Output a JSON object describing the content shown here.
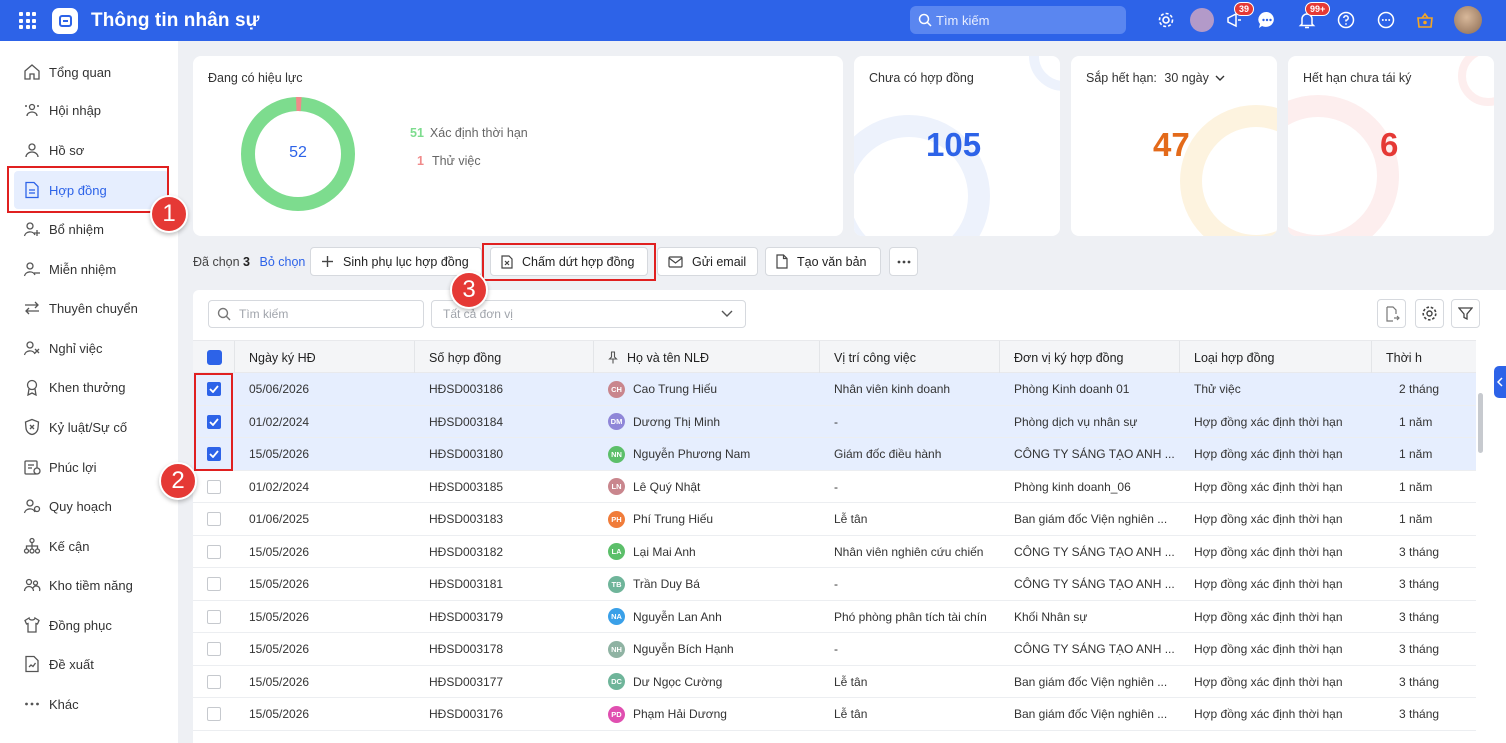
{
  "header": {
    "title": "Thông tin nhân sự",
    "search_placeholder": "Tìm kiếm",
    "announce_badge": "39",
    "notify_badge": "99+"
  },
  "sidebar": {
    "items": [
      {
        "label": "Tổng quan",
        "icon": "home-icon"
      },
      {
        "label": "Hội nhập",
        "icon": "onboarding-icon"
      },
      {
        "label": "Hồ sơ",
        "icon": "user-icon"
      },
      {
        "label": "Hợp đồng",
        "icon": "contract-icon",
        "active": true
      },
      {
        "label": "Bổ nhiệm",
        "icon": "user-plus-icon"
      },
      {
        "label": "Miễn nhiệm",
        "icon": "user-minus-icon"
      },
      {
        "label": "Thuyên chuyển",
        "icon": "transfer-icon"
      },
      {
        "label": "Nghỉ việc",
        "icon": "user-x-icon"
      },
      {
        "label": "Khen thưởng",
        "icon": "reward-icon"
      },
      {
        "label": "Kỷ luật/Sự cố",
        "icon": "shield-icon"
      },
      {
        "label": "Phúc lợi",
        "icon": "benefit-icon"
      },
      {
        "label": "Quy hoạch",
        "icon": "planning-icon"
      },
      {
        "label": "Kế cận",
        "icon": "hierarchy-icon"
      },
      {
        "label": "Kho tiềm năng",
        "icon": "talent-pool-icon"
      },
      {
        "label": "Đồng phục",
        "icon": "shirt-icon"
      },
      {
        "label": "Đề xuất",
        "icon": "proposal-icon"
      },
      {
        "label": "Khác",
        "icon": "more-icon"
      }
    ]
  },
  "cards": {
    "effective": {
      "title": "Đang có hiệu lực",
      "total": "52",
      "legend": [
        {
          "count": "51",
          "label": "Xác định thời hạn",
          "color": "#7ddc8e"
        },
        {
          "count": "1",
          "label": "Thử việc",
          "color": "#f08a8a"
        }
      ]
    },
    "no_contract": {
      "title": "Chưa có hợp đồng",
      "value": "105",
      "color": "#2d63e8"
    },
    "expiring": {
      "title": "Sắp hết hạn:",
      "period": "30 ngày",
      "value": "47",
      "color": "#e36a1a"
    },
    "expired": {
      "title": "Hết hạn chưa tái ký",
      "value": "6",
      "color": "#e53935"
    }
  },
  "actions": {
    "selected_prefix": "Đã chọn",
    "selected_count": "3",
    "deselect": "Bỏ chọn",
    "buttons": [
      "Sinh phụ lục hợp đồng",
      "Chấm dứt hợp đồng",
      "Gửi email",
      "Tạo văn bản"
    ]
  },
  "table": {
    "search_placeholder": "Tìm kiếm",
    "unit_placeholder": "Tất cả đơn vị",
    "columns": [
      "Ngày ký HĐ",
      "Số hợp đồng",
      "Họ và tên NLĐ",
      "Vị trí công việc",
      "Đơn vị ký hợp đồng",
      "Loại hợp đồng",
      "Thời h"
    ],
    "rows": [
      {
        "selected": true,
        "date": "05/06/2026",
        "number": "HĐSD003186",
        "initials": "CH",
        "avatar_color": "#c9868d",
        "name": "Cao Trung Hiếu",
        "position": "Nhân viên kinh doanh",
        "unit": "Phòng Kinh doanh 01",
        "type": "Thử việc",
        "term": "2 tháng"
      },
      {
        "selected": true,
        "date": "01/02/2024",
        "number": "HĐSD003184",
        "initials": "DM",
        "avatar_color": "#8f86d8",
        "name": "Dương Thị Minh",
        "position": "-",
        "unit": "Phòng dịch vụ nhân sự",
        "type": "Hợp đồng xác định thời hạn",
        "term": "1 năm"
      },
      {
        "selected": true,
        "date": "15/05/2026",
        "number": "HĐSD003180",
        "initials": "NN",
        "avatar_color": "#5cbf6a",
        "name": "Nguyễn Phương Nam",
        "position": "Giám đốc điều hành",
        "unit": "CÔNG TY SÁNG TẠO ANH ...",
        "type": "Hợp đồng xác định thời hạn",
        "term": "1 năm"
      },
      {
        "selected": false,
        "date": "01/02/2024",
        "number": "HĐSD003185",
        "initials": "LN",
        "avatar_color": "#c9868d",
        "name": "Lê Quý Nhật",
        "position": "-",
        "unit": "Phòng kinh doanh_06",
        "type": "Hợp đồng xác định thời hạn",
        "term": "1 năm"
      },
      {
        "selected": false,
        "date": "01/06/2025",
        "number": "HĐSD003183",
        "initials": "PH",
        "avatar_color": "#f07c3a",
        "name": "Phí Trung Hiếu",
        "position": "Lễ tân",
        "unit": "Ban giám đốc Viện nghiên ...",
        "type": "Hợp đồng xác định thời hạn",
        "term": "1 năm"
      },
      {
        "selected": false,
        "date": "15/05/2026",
        "number": "HĐSD003182",
        "initials": "LA",
        "avatar_color": "#5cbf6a",
        "name": "Lại Mai Anh",
        "position": "Nhân viên nghiên cứu chiến l",
        "unit": "CÔNG TY SÁNG TẠO ANH ...",
        "type": "Hợp đồng xác định thời hạn",
        "term": "3 tháng"
      },
      {
        "selected": false,
        "date": "15/05/2026",
        "number": "HĐSD003181",
        "initials": "TB",
        "avatar_color": "#6fb59a",
        "name": "Trần Duy Bá",
        "position": "-",
        "unit": "CÔNG TY SÁNG TẠO ANH ...",
        "type": "Hợp đồng xác định thời hạn",
        "term": "3 tháng"
      },
      {
        "selected": false,
        "date": "15/05/2026",
        "number": "HĐSD003179",
        "initials": "NA",
        "avatar_color": "#3aa0e8",
        "name": "Nguyễn Lan Anh",
        "position": "Phó phòng phân tích tài chính",
        "unit": "Khối Nhân sự",
        "type": "Hợp đồng xác định thời hạn",
        "term": "3 tháng"
      },
      {
        "selected": false,
        "date": "15/05/2026",
        "number": "HĐSD003178",
        "initials": "NH",
        "avatar_color": "#8fb3a3",
        "name": "Nguyễn Bích Hạnh",
        "position": "-",
        "unit": "CÔNG TY SÁNG TẠO ANH ...",
        "type": "Hợp đồng xác định thời hạn",
        "term": "3 tháng"
      },
      {
        "selected": false,
        "date": "15/05/2026",
        "number": "HĐSD003177",
        "initials": "DC",
        "avatar_color": "#6fb59a",
        "name": "Dư Ngọc Cường",
        "position": "Lễ tân",
        "unit": "Ban giám đốc Viện nghiên ...",
        "type": "Hợp đồng xác định thời hạn",
        "term": "3 tháng"
      },
      {
        "selected": false,
        "date": "15/05/2026",
        "number": "HĐSD003176",
        "initials": "PD",
        "avatar_color": "#e04fb0",
        "name": "Phạm Hải Dương",
        "position": "Lễ tân",
        "unit": "Ban giám đốc Viện nghiên ...",
        "type": "Hợp đồng xác định thời hạn",
        "term": "3 tháng"
      }
    ]
  },
  "annotations": {
    "marker_1": "1",
    "marker_2": "2",
    "marker_3": "3"
  }
}
